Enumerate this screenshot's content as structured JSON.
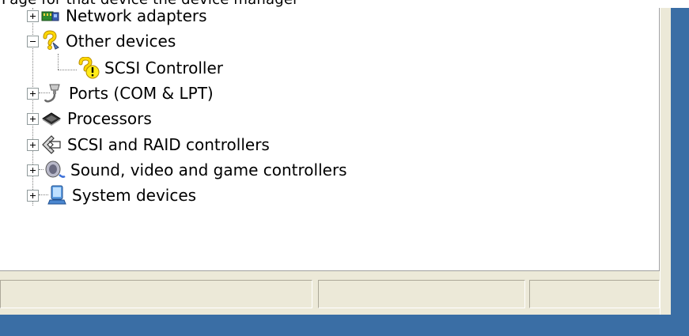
{
  "window": {
    "title_fragment": "Page for that device the device manager"
  },
  "tree": {
    "items": [
      {
        "label": "Network adapters",
        "icon": "network-adapter-icon",
        "expander": "plus"
      },
      {
        "label": "Other devices",
        "icon": "unknown-device-icon",
        "expander": "minus"
      },
      {
        "label": "SCSI Controller",
        "icon": "device-warning-icon",
        "expander": "none"
      },
      {
        "label": "Ports (COM & LPT)",
        "icon": "port-icon",
        "expander": "plus"
      },
      {
        "label": "Processors",
        "icon": "processor-icon",
        "expander": "plus"
      },
      {
        "label": "SCSI and RAID controllers",
        "icon": "scsi-icon",
        "expander": "plus"
      },
      {
        "label": "Sound, video and game controllers",
        "icon": "speaker-icon",
        "expander": "plus"
      },
      {
        "label": "System devices",
        "icon": "system-device-icon",
        "expander": "plus"
      }
    ]
  },
  "statusbar": {
    "panels": [
      "",
      "",
      ""
    ]
  },
  "colors": {
    "desktop": "#3a6ea5",
    "chrome": "#ece9d8",
    "pane": "#ffffff"
  }
}
